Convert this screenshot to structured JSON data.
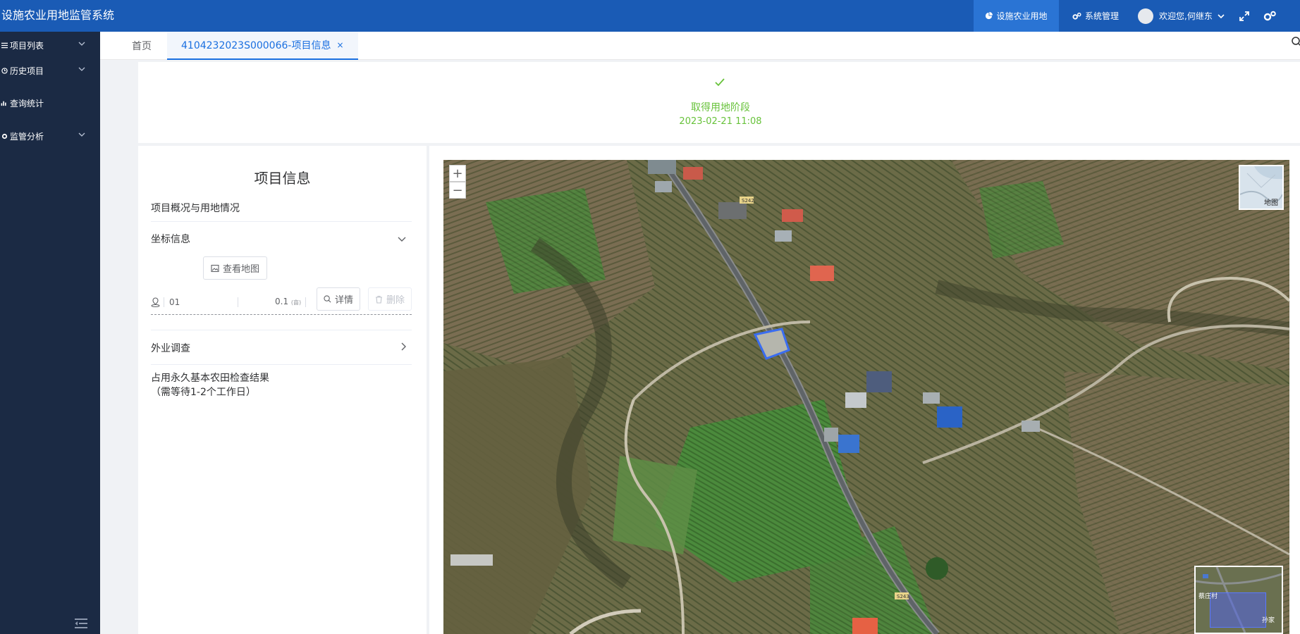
{
  "header": {
    "app_title": "设施农业用地监管系统",
    "nav_active": "设施农业用地",
    "nav_system": "系统管理",
    "welcome": "欢迎您,何继东"
  },
  "sidebar": {
    "items": [
      {
        "label": "项目列表",
        "icon": "list-icon",
        "has_chevron": true
      },
      {
        "label": "历史项目",
        "icon": "history-icon",
        "has_chevron": true
      },
      {
        "label": "查询统计",
        "icon": "chart-icon",
        "has_chevron": false
      },
      {
        "label": "监管分析",
        "icon": "gear-icon",
        "has_chevron": true
      }
    ]
  },
  "tabs": {
    "home": "首页",
    "active": "4104232023S000066-项目信息",
    "close": "×"
  },
  "stage": {
    "name": "取得用地阶段",
    "date": "2023-02-21 11:08"
  },
  "info": {
    "title": "项目信息",
    "overview_label": "项目概况与用地情况",
    "coord_label": "坐标信息",
    "view_map_button": "查看地图",
    "coord_id": "01",
    "coord_area": "0.1",
    "coord_unit": "(亩)",
    "detail_button": "详情",
    "delete_button": "删除",
    "field_survey": "外业调查",
    "farmland_check_title": "占用永久基本农田检查结果",
    "farmland_check_note": "（需等待1-2个工作日）"
  },
  "map": {
    "zoom_in": "+",
    "zoom_out": "−",
    "basemap_label": "地图",
    "road_label_1": "S242",
    "road_label_2": "S243",
    "overview_label_1": "蔡庄村",
    "overview_label_2": "孙家"
  },
  "colors": {
    "header_bg": "#1a5bb5",
    "sidebar_bg": "#1b2a44",
    "accent": "#1a6fe0",
    "success": "#67c23a",
    "parcel_outline": "#3a6df0"
  }
}
